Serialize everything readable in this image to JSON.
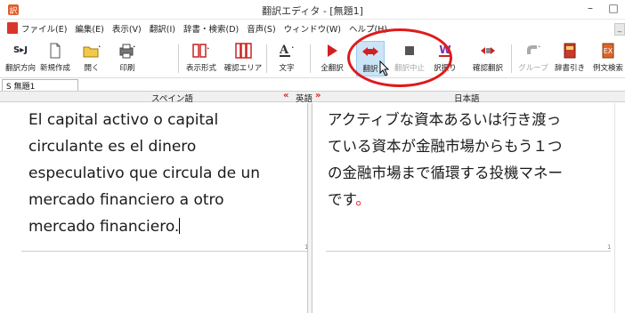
{
  "window": {
    "title": "翻訳エディタ - [無題1]",
    "minimize": "–",
    "maximize": "□"
  },
  "menu": {
    "items": [
      "ファイル(E)",
      "編集(E)",
      "表示(V)",
      "翻訳(I)",
      "辞書・検索(D)",
      "音声(S)",
      "ウィンドウ(W)",
      "ヘルプ(H)"
    ]
  },
  "toolbar": {
    "buttons": {
      "direction": "翻訳方向",
      "new": "新規作成",
      "open": "開く",
      "print": "印刷",
      "display": "表示形式",
      "confirm_area": "確認エリア",
      "font": "文字",
      "translate_all": "全翻訳",
      "translate": "翻訳",
      "translate_stop": "翻訳中止",
      "reassign": "訳振り",
      "confirm_translation": "確認翻訳",
      "group": "グループ",
      "dictionary": "辞書引き",
      "example_search": "例文検索"
    },
    "direction_icon": "S▸J",
    "highlight_color": "#e01a1a"
  },
  "document_tab": {
    "label": "S 無題1"
  },
  "panes": {
    "left_header": "スペイン語",
    "middle_left_arrow": "«",
    "middle_label": "英語",
    "middle_right_arrow": "»",
    "right_header": "日本語",
    "source_lines": [
      "El capital activo o capital",
      "circulante es el dinero",
      "especulativo que circula de un",
      "mercado financiero a otro",
      "mercado financiero."
    ],
    "target_lines": [
      "アクティブな資本あるいは行き渡っ",
      "ている資本が金融市場からもう１つ",
      "の金融市場まで循環する投機マネー",
      "です"
    ],
    "target_end_mark": "。",
    "left_para_number": "1",
    "right_para_number": "1"
  }
}
